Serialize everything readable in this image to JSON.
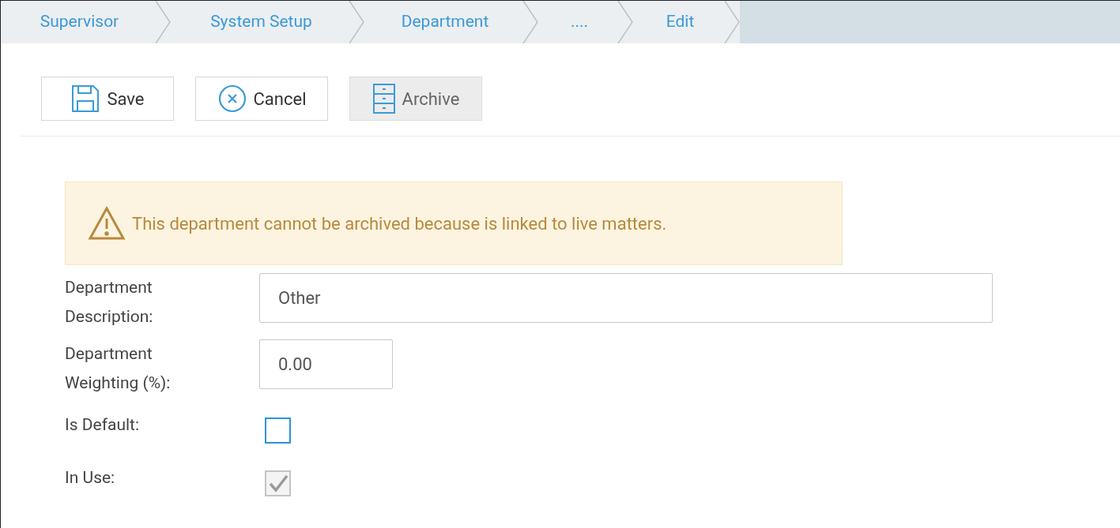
{
  "breadcrumb": [
    {
      "label": "Supervisor"
    },
    {
      "label": "System Setup"
    },
    {
      "label": "Department"
    },
    {
      "label": "...."
    },
    {
      "label": "Edit"
    }
  ],
  "toolbar": [
    {
      "label": "Save",
      "disabled": false
    },
    {
      "label": "Cancel",
      "disabled": false
    },
    {
      "label": "Archive",
      "disabled": true
    }
  ],
  "alert": {
    "text": "This department cannot be archived because is linked to live matters."
  },
  "fields": [
    {
      "kind": "text",
      "label": "Department Description:",
      "value": "Other"
    },
    {
      "kind": "text",
      "label": "Department Weighting (%):",
      "value": "0.00"
    },
    {
      "kind": "checkbox",
      "label": "Is Default:",
      "checked": false,
      "disabled": false
    },
    {
      "kind": "checkbox",
      "label": "In Use:",
      "checked": true,
      "disabled": true
    }
  ]
}
